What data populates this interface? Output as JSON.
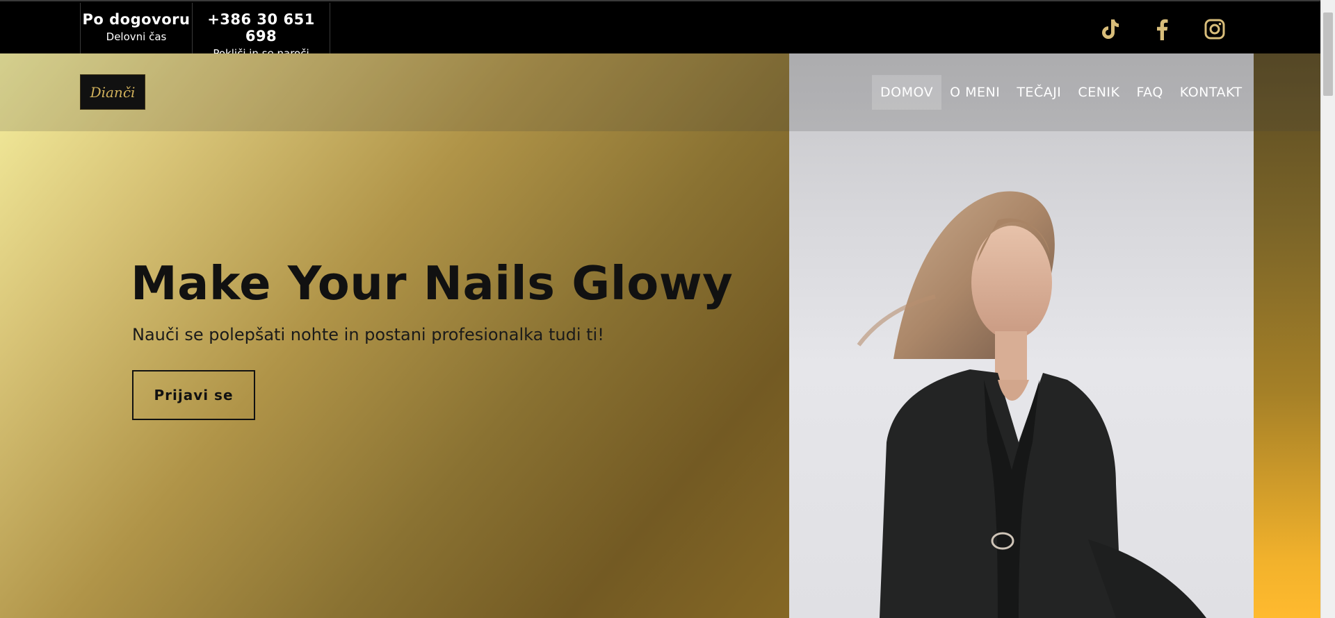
{
  "topbar": {
    "hours_title": "Po dogovoru",
    "hours_subtitle": "Delovni čas",
    "phone_title": "+386 30 651 698",
    "phone_subtitle": "Pokliči in se naroči"
  },
  "social": {
    "icons": [
      "tiktok-icon",
      "facebook-icon",
      "instagram-icon"
    ],
    "icon_color": "#d8bd7a"
  },
  "header": {
    "logo_text": "Dianči",
    "nav": [
      {
        "label": "DOMOV",
        "active": true
      },
      {
        "label": "O MENI",
        "active": false
      },
      {
        "label": "TEČAJI",
        "active": false
      },
      {
        "label": "CENIK",
        "active": false
      },
      {
        "label": "FAQ",
        "active": false
      },
      {
        "label": "KONTAKT",
        "active": false
      }
    ]
  },
  "hero": {
    "headline": "Make Your Nails Glowy",
    "subline": "Nauči se polepšati nohte in postani profesionalka tudi ti!",
    "cta_label": "Prijavi se"
  },
  "colors": {
    "topbar_bg": "#000000",
    "gold_light": "#f6f0a0",
    "gold_dark": "#735a23",
    "text_dark": "#111111"
  }
}
